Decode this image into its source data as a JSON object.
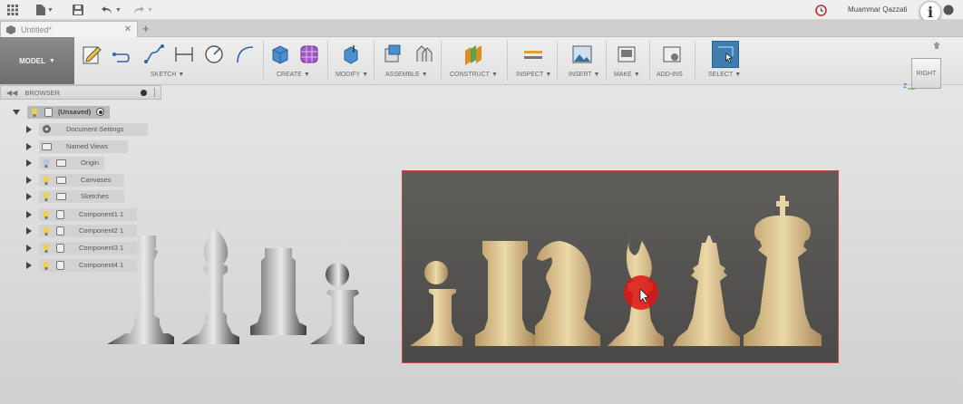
{
  "app": {
    "tab_title": "Untitled*",
    "user_name": "Muammar Qazzati",
    "info_glyph": "i"
  },
  "ribbon": {
    "workspace": "MODEL",
    "groups": [
      {
        "label": "SKETCH",
        "has_menu": true
      },
      {
        "label": "CREATE",
        "has_menu": true
      },
      {
        "label": "MODIFY",
        "has_menu": true
      },
      {
        "label": "ASSEMBLE",
        "has_menu": true
      },
      {
        "label": "CONSTRUCT",
        "has_menu": true
      },
      {
        "label": "INSPECT",
        "has_menu": true
      },
      {
        "label": "INSERT",
        "has_menu": true
      },
      {
        "label": "MAKE",
        "has_menu": true
      },
      {
        "label": "ADD-INS",
        "has_menu": false
      },
      {
        "label": "SELECT",
        "has_menu": true
      }
    ]
  },
  "browser": {
    "title": "BROWSER",
    "root": "(Unsaved)",
    "items": [
      {
        "label": "Document Settings",
        "icon": "gear-icon"
      },
      {
        "label": "Named Views",
        "icon": "folder-icon"
      },
      {
        "label": "Origin",
        "icon": "folder-icon"
      },
      {
        "label": "Canvases",
        "icon": "folder-icon"
      },
      {
        "label": "Sketches",
        "icon": "folder-icon"
      },
      {
        "label": "Component1 1",
        "icon": "component-icon"
      },
      {
        "label": "Component2 1",
        "icon": "component-icon"
      },
      {
        "label": "Component3 1",
        "icon": "component-icon"
      },
      {
        "label": "Component4 1",
        "icon": "component-icon"
      }
    ]
  },
  "viewcube": {
    "face": "RIGHT",
    "axis_z": "Z"
  },
  "colors": {
    "accent_select": "#3d7eb3",
    "canvas_border": "#c04848",
    "cursor_halo": "#dc1414"
  }
}
